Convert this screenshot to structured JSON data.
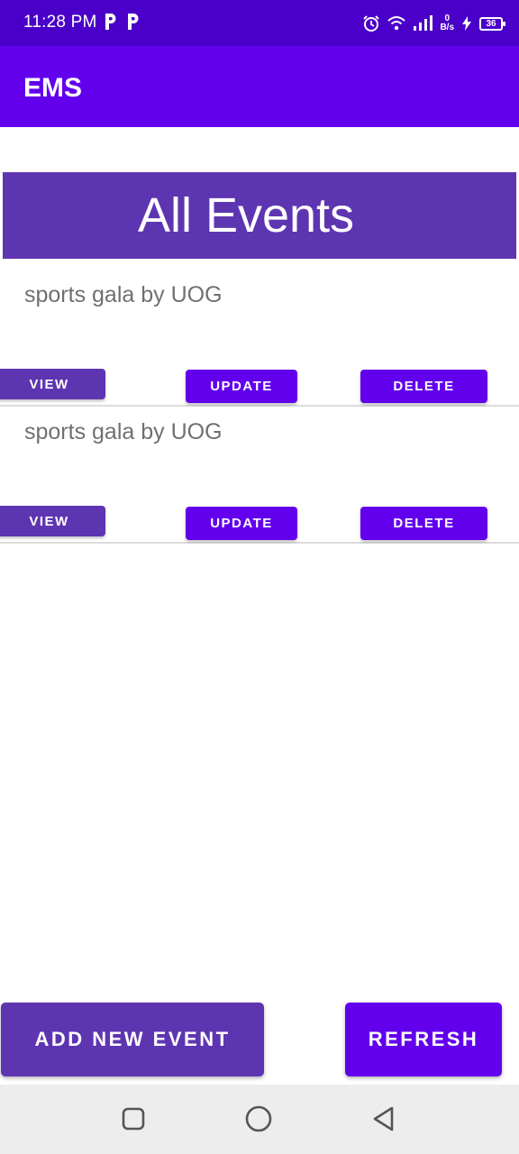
{
  "status_bar": {
    "time": "11:28 PM",
    "net_speed_value": "0",
    "net_speed_unit": "B/s",
    "battery_level": "36",
    "icons": [
      "p-icon",
      "p-icon",
      "alarm-icon",
      "wifi-icon",
      "signal-icon",
      "charging-icon",
      "battery-icon"
    ]
  },
  "app_bar": {
    "title": "EMS"
  },
  "main": {
    "heading": "All Events",
    "events": [
      {
        "title": "sports gala by UOG",
        "view_label": "VIEW",
        "update_label": "UPDATE",
        "delete_label": "DELETE"
      },
      {
        "title": "sports gala by UOG",
        "view_label": "VIEW",
        "update_label": "UPDATE",
        "delete_label": "DELETE"
      }
    ]
  },
  "actions": {
    "add_label": "ADD NEW EVENT",
    "refresh_label": "REFRESH"
  },
  "nav_bar": {
    "icons": [
      "recents-icon",
      "home-icon",
      "back-icon"
    ]
  },
  "colors": {
    "status_bar": "#4a00c8",
    "primary": "#6200ee",
    "secondary": "#5e35b1",
    "event_text": "#707070",
    "nav_bar": "#ededed"
  }
}
